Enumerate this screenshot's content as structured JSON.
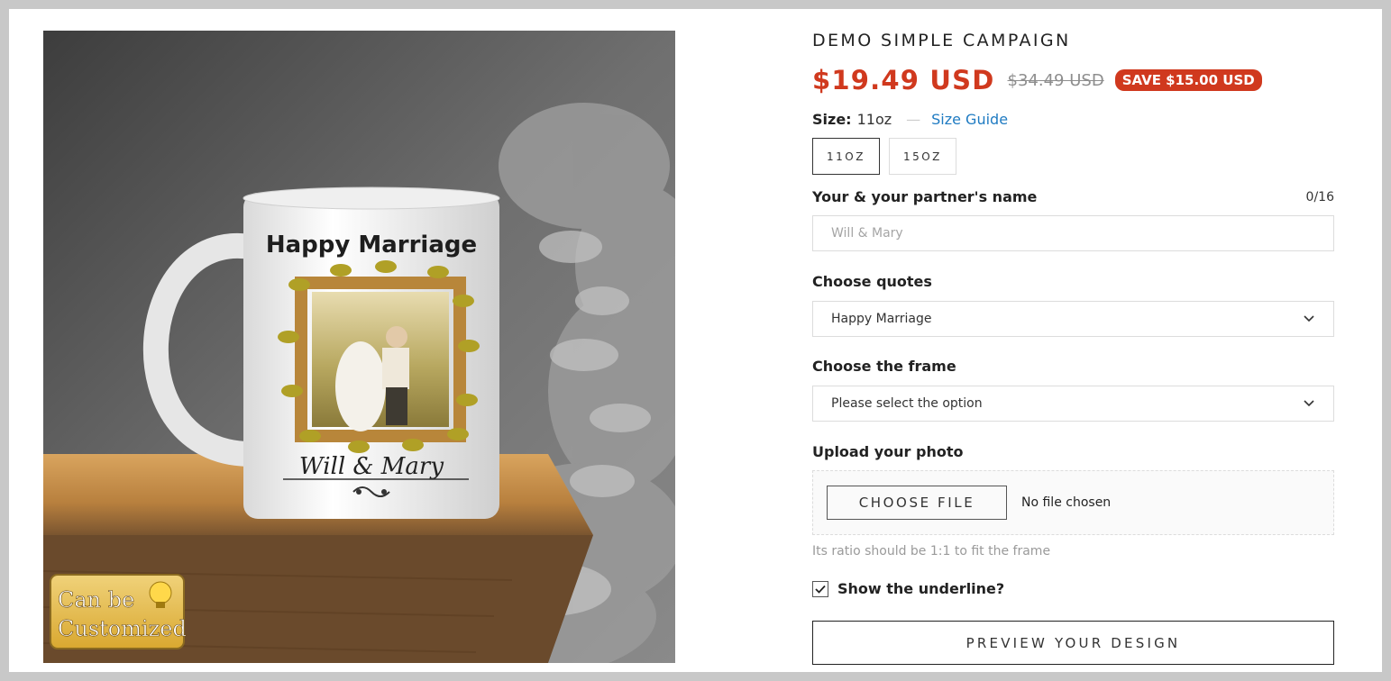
{
  "product": {
    "title": "DEMO SIMPLE CAMPAIGN",
    "price_sale": "$19.49 USD",
    "price_compare": "$34.49 USD",
    "save_badge": "SAVE $15.00 USD",
    "colors": {
      "accent": "#d0391e",
      "link": "#1f7bc2"
    }
  },
  "image": {
    "mug_title": "Happy Marriage",
    "mug_names": "Will & Mary",
    "badge_line1": "Can be",
    "badge_line2": "Customized"
  },
  "size": {
    "label": "Size:",
    "value": "11oz",
    "separator": "—",
    "guide_link": "Size Guide",
    "options": [
      "11OZ",
      "15OZ"
    ],
    "selected": "11OZ"
  },
  "name_field": {
    "label": "Your & your partner's name",
    "counter": "0/16",
    "placeholder": "Will & Mary",
    "value": ""
  },
  "quotes_field": {
    "label": "Choose quotes",
    "selected": "Happy Marriage"
  },
  "frame_field": {
    "label": "Choose the frame",
    "selected": "Please select the option"
  },
  "upload_field": {
    "label": "Upload your photo",
    "button": "CHOOSE FILE",
    "status": "No file chosen",
    "hint": "Its ratio should be 1:1 to fit the frame"
  },
  "underline_option": {
    "label": "Show the underline?",
    "checked": true
  },
  "preview_button": "PREVIEW YOUR DESIGN"
}
